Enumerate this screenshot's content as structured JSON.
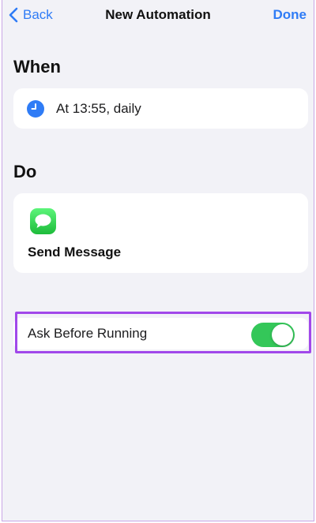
{
  "nav": {
    "back_label": "Back",
    "title": "New Automation",
    "done_label": "Done"
  },
  "when": {
    "heading": "When",
    "trigger_label": "At 13:55, daily",
    "icon": "clock-icon"
  },
  "do": {
    "heading": "Do",
    "action_label": "Send Message",
    "icon": "messages-app-icon"
  },
  "ask_before_running": {
    "label": "Ask Before Running",
    "enabled": true
  },
  "colors": {
    "accent": "#2f7cf6",
    "toggle_on": "#34c759",
    "highlight": "#a148ea",
    "background": "#f2f2f7"
  }
}
